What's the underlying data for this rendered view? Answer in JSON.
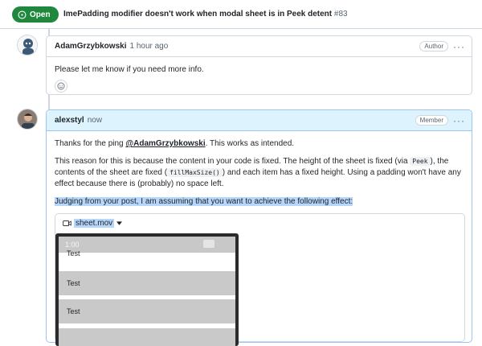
{
  "issue": {
    "state": "Open",
    "title": "ImePadding modifier doesn't work when modal sheet is in Peek detent",
    "number": "#83"
  },
  "comments": [
    {
      "author": "AdamGrzybkowski",
      "time": "1 hour ago",
      "role": "Author",
      "body": "Please let me know if you need more info."
    },
    {
      "author": "alexstyl",
      "time": "now",
      "role": "Member",
      "p1_pre": "Thanks for the ping ",
      "p1_mention": "@AdamGrzybkowski",
      "p1_post": ". This works as intended.",
      "p2_a": "This reason for this is because the content in your code is fixed. The height of the sheet is fixed (via ",
      "p2_code1": "Peek",
      "p2_b": "), the contents of the sheet are fixed (",
      "p2_code2": "fillMaxSize()",
      "p2_c": ") and each item has a fixed height. Using a padding won't have any effect because there is (probably) no space left.",
      "p3": "Judging from your post, I am assuming that you want to achieve the following effect:",
      "attachment": "sheet.mov"
    }
  ],
  "video": {
    "status_time": "1:00",
    "rows": [
      "Test",
      "Test",
      "Test"
    ]
  },
  "colors": {
    "open_green": "#1f883d",
    "member_header": "#ddf4ff",
    "selection": "#b6d6fb"
  }
}
